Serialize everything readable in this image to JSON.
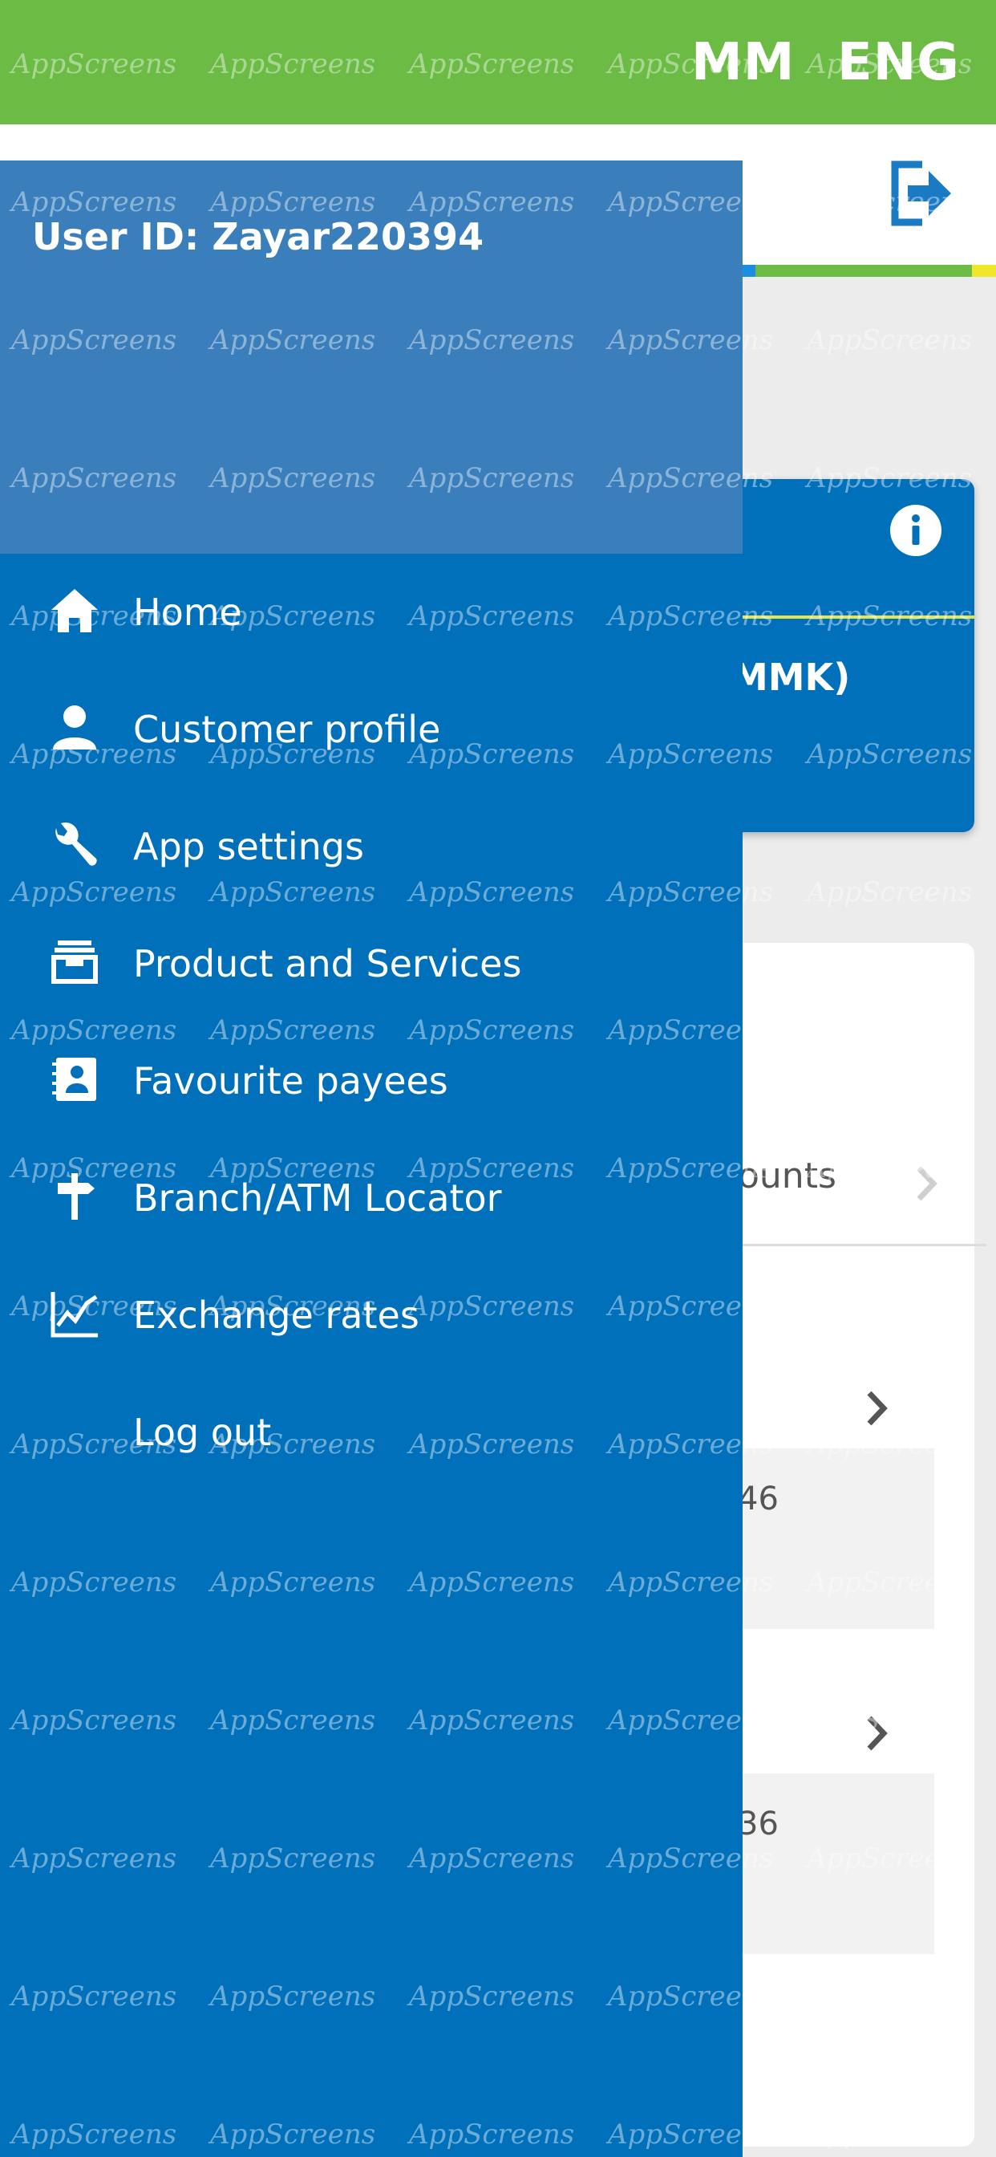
{
  "topbar": {
    "lang_mm": "MM",
    "lang_eng": "ENG"
  },
  "header": {
    "logout_icon": "logout-icon"
  },
  "background": {
    "card_currency": "MMK)",
    "accounts_text": "ounts",
    "account1_number": "46",
    "account2_number": "36"
  },
  "drawer": {
    "user_id": "User ID: Zayar220394",
    "items": [
      {
        "label": "Home",
        "icon": "home-icon"
      },
      {
        "label": "Customer profile",
        "icon": "person-icon"
      },
      {
        "label": "App settings",
        "icon": "wrench-icon"
      },
      {
        "label": "Product and Services",
        "icon": "archive-icon"
      },
      {
        "label": "Favourite payees",
        "icon": "contacts-book-icon"
      },
      {
        "label": "Branch/ATM Locator",
        "icon": "signpost-icon"
      },
      {
        "label": "Exchange rates",
        "icon": "line-chart-icon"
      },
      {
        "label": "Log out",
        "icon": ""
      }
    ]
  },
  "watermark": {
    "text": "AppScreens"
  },
  "colors": {
    "topbar_green": "#6cbb45",
    "drawer_blue": "#0070bb",
    "drawer_header_blue": "#3a7ebb"
  }
}
